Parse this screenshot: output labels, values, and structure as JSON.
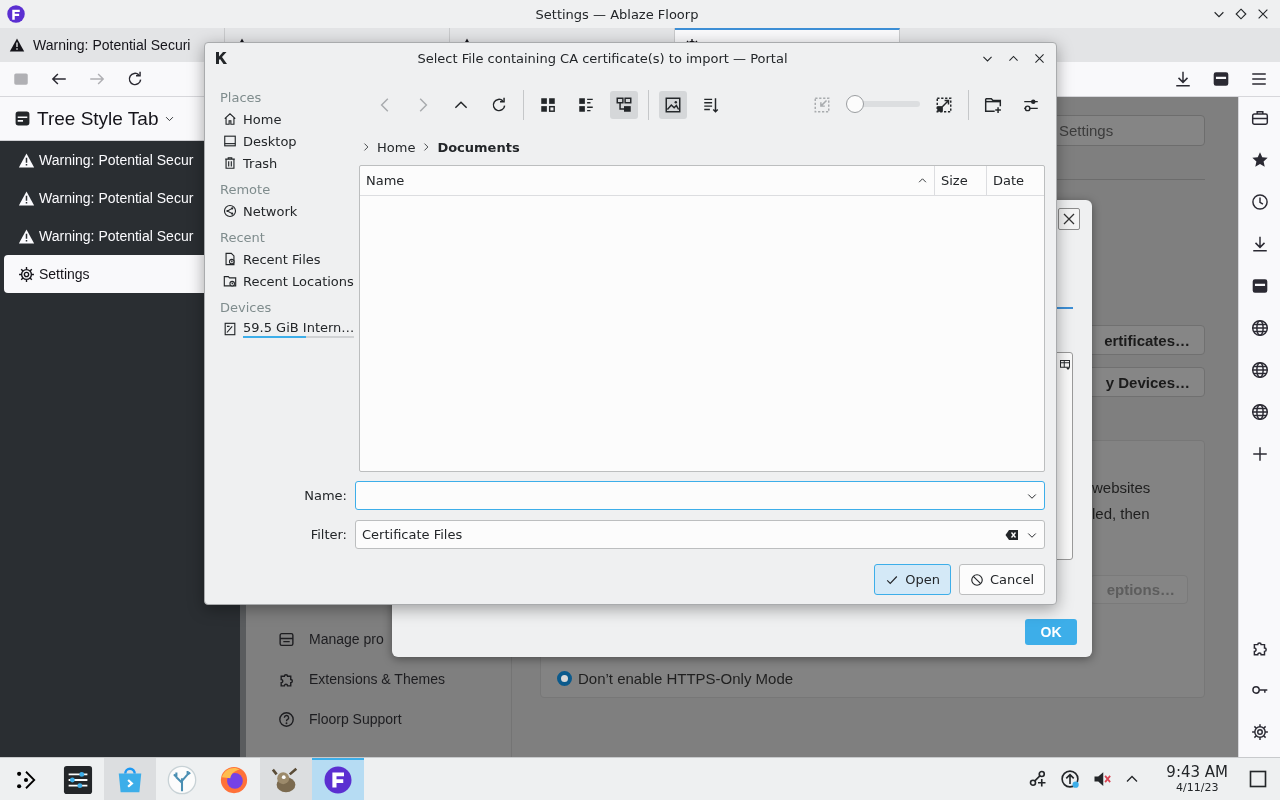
{
  "window": {
    "title": "Settings — Ablaze Floorp"
  },
  "tabs": [
    {
      "kind": "warning",
      "label": "Warning: Potential Securi",
      "selected": false
    },
    {
      "kind": "warning",
      "selected": false
    },
    {
      "kind": "warning",
      "selected": false
    },
    {
      "kind": "settings",
      "selected": true
    }
  ],
  "tree_sidebar": {
    "title": "Tree Style Tab",
    "items": [
      {
        "kind": "warning",
        "label": "Warning: Potential Secur",
        "selected": false
      },
      {
        "kind": "warning",
        "label": "Warning: Potential Secur",
        "selected": false
      },
      {
        "kind": "warning",
        "label": "Warning: Potential Secur",
        "selected": false
      },
      {
        "kind": "settings",
        "label": "Settings",
        "selected": true
      }
    ]
  },
  "settings_page": {
    "search": {
      "placeholder": "Settings"
    },
    "nav": [
      {
        "kind": "profiles",
        "label": "Manage pro"
      },
      {
        "kind": "extensions",
        "label": "Extensions & Themes"
      },
      {
        "kind": "support",
        "label": "Floorp Support"
      }
    ],
    "buttons": [
      "ertificates…",
      "y Devices…"
    ],
    "https_section": {
      "lines": [
        "websites",
        "led, then"
      ],
      "button": "eptions…",
      "option": {
        "label": "Don’t enable HTTPS-Only Mode",
        "selected": true
      }
    }
  },
  "certificate_dialog": {
    "ok": "OK"
  },
  "file_dialog": {
    "title": "Select File containing CA certificate(s) to import — Portal",
    "places": [
      {
        "heading": "Places",
        "items": [
          {
            "kind": "home",
            "label": "Home"
          },
          {
            "kind": "desktop",
            "label": "Desktop"
          },
          {
            "kind": "trash",
            "label": "Trash"
          }
        ]
      },
      {
        "heading": "Remote",
        "items": [
          {
            "kind": "network",
            "label": "Network"
          }
        ]
      },
      {
        "heading": "Recent",
        "items": [
          {
            "kind": "recent-files",
            "label": "Recent Files"
          },
          {
            "kind": "recent-locations",
            "label": "Recent Locations"
          }
        ]
      },
      {
        "heading": "Devices",
        "items": [
          {
            "kind": "drive",
            "label": "59.5 GiB Intern…",
            "level": 0.57
          }
        ]
      }
    ],
    "view_buttons": [
      {
        "kind": "icons",
        "selected": false
      },
      {
        "kind": "compact",
        "selected": false
      },
      {
        "kind": "tree",
        "selected": true
      }
    ],
    "preview": {
      "selected": true
    },
    "zoom": {
      "level": 0
    },
    "breadcrumb": [
      "Home",
      "Documents"
    ],
    "columns": [
      {
        "label": "Name",
        "sorted": true
      },
      {
        "label": "Size",
        "sorted": false
      },
      {
        "label": "Date",
        "sorted": false
      }
    ],
    "name_field": {
      "label": "Name:"
    },
    "filter_field": {
      "label": "Filter:",
      "value": "Certificate Files"
    },
    "buttons": [
      {
        "kind": "open",
        "label": "Open",
        "default": true
      },
      {
        "kind": "cancel",
        "label": "Cancel",
        "default": false
      }
    ]
  },
  "taskbar": {
    "apps": [
      {
        "kind": "launcher",
        "open": false,
        "active": false
      },
      {
        "kind": "system-settings",
        "open": false,
        "active": false
      },
      {
        "kind": "store",
        "open": true,
        "active": false
      },
      {
        "kind": "coral",
        "open": false,
        "active": false
      },
      {
        "kind": "firefox",
        "open": false,
        "active": false
      },
      {
        "kind": "gimp",
        "open": true,
        "active": false
      },
      {
        "kind": "floorp",
        "open": true,
        "active": true
      }
    ],
    "clock": {
      "time": "9:43 AM",
      "date": "4/11/23"
    }
  }
}
